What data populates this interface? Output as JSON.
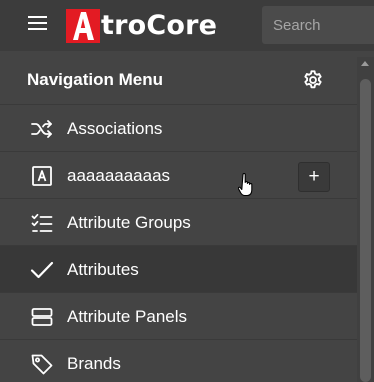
{
  "header": {
    "logo_text": "troCore",
    "logo_mark_letter": "A",
    "brand_color": "#e31b23",
    "search_placeholder": "Search"
  },
  "sidebar": {
    "title": "Navigation Menu",
    "items": [
      {
        "label": "Associations",
        "icon": "shuffle-icon",
        "active": false
      },
      {
        "label": "aaaaaaaaaas",
        "icon": "letter-a-box-icon",
        "active": false,
        "action": "+"
      },
      {
        "label": "Attribute Groups",
        "icon": "checklist-icon",
        "active": false
      },
      {
        "label": "Attributes",
        "icon": "checkmark-icon",
        "active": true
      },
      {
        "label": "Attribute Panels",
        "icon": "panels-icon",
        "active": false
      },
      {
        "label": "Brands",
        "icon": "tag-icon",
        "active": false
      }
    ]
  }
}
